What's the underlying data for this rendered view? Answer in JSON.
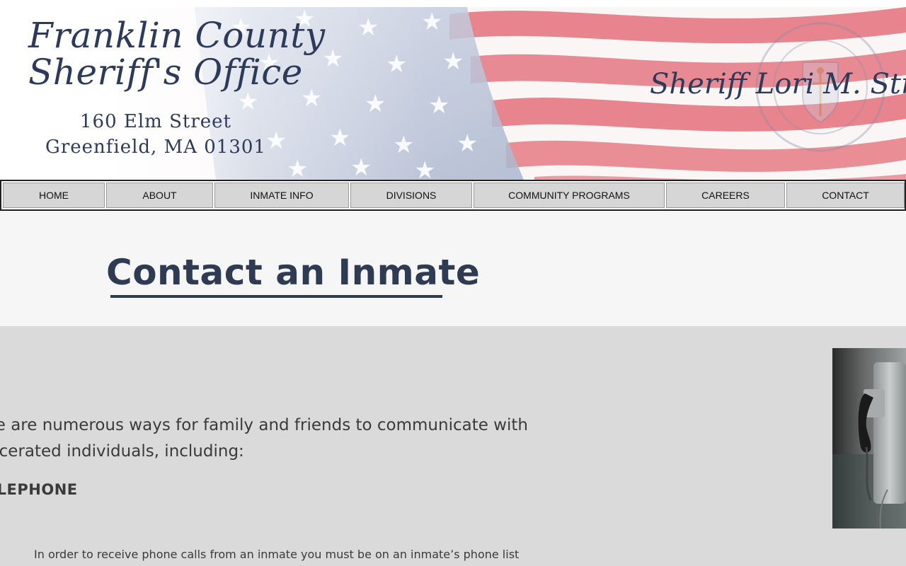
{
  "header": {
    "title_line1": "Franklin County",
    "title_line2": "Sheriff's Office",
    "address_line1": "160 Elm Street",
    "address_line2": "Greenfield, MA 01301",
    "sheriff_name": "Sheriff Lori M. Streeter"
  },
  "nav": {
    "items": [
      {
        "label": "HOME"
      },
      {
        "label": "ABOUT"
      },
      {
        "label": "INMATE INFO"
      },
      {
        "label": "DIVISIONS"
      },
      {
        "label": "COMMUNITY PROGRAMS"
      },
      {
        "label": "CAREERS"
      },
      {
        "label": "CONTACT"
      }
    ]
  },
  "page": {
    "title": "Contact an Inmate"
  },
  "content": {
    "intro_line1": "There are numerous ways for family and friends to communicate with",
    "intro_line2": "incarcerated individuals, including:",
    "section_heading": "TELEPHONE",
    "phone_text": "In order to receive phone calls from an inmate you must be on an inmate’s phone list"
  },
  "colors": {
    "navy": "#2d3a5a",
    "nav_button": "#d6d6d6",
    "title_band": "#f6f6f6",
    "content_band": "#dadada",
    "flag_red": "#e8818b",
    "flag_blue": "#b9c4d9"
  },
  "icons": {
    "seal": "massachusetts-seal-icon",
    "flag": "american-flag-background",
    "photo": "wall-telephone-photo"
  }
}
